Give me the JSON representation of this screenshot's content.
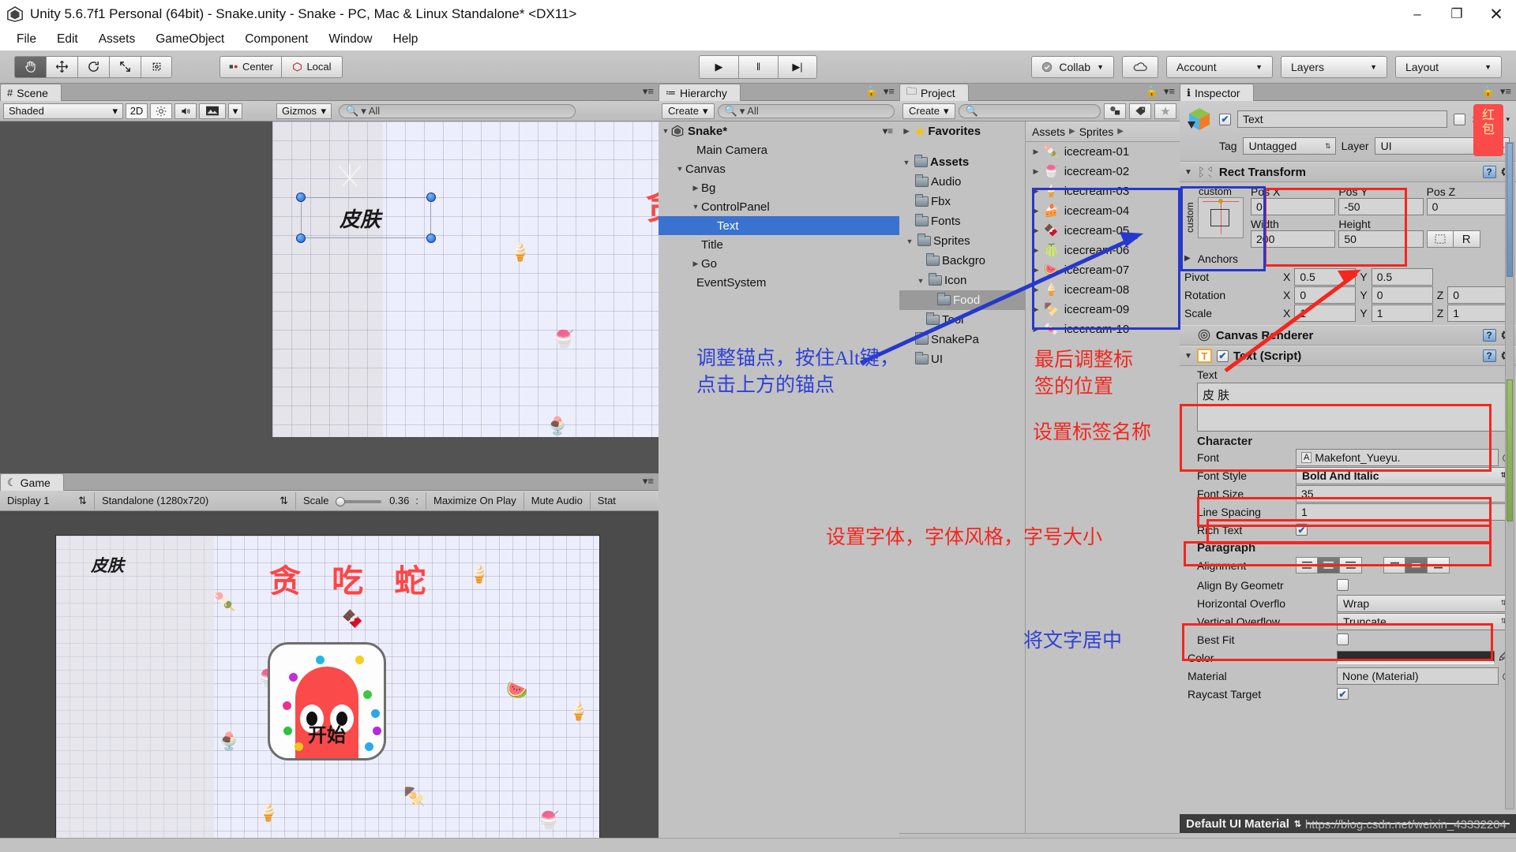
{
  "window": {
    "title": "Unity 5.6.7f1 Personal (64bit) - Snake.unity - Snake - PC, Mac & Linux Standalone* <DX11>",
    "minimize": "–",
    "maximize": "❐",
    "close": "✕"
  },
  "menubar": {
    "items": [
      "File",
      "Edit",
      "Assets",
      "GameObject",
      "Component",
      "Window",
      "Help"
    ]
  },
  "toolbar": {
    "tools": [
      "hand-tool",
      "move-tool",
      "rotate-tool",
      "scale-tool",
      "rect-tool"
    ],
    "pivot_mode": "Center",
    "pivot_rotation": "Local",
    "play": "▶",
    "pause": "‖",
    "step": "▶|",
    "collab": "Collab",
    "cloud": "☁",
    "account": "Account",
    "layers": "Layers",
    "layout": "Layout"
  },
  "scene": {
    "tab": "Scene",
    "tab_icon": "grid-icon",
    "draw_mode": "Shaded",
    "mode_2d": "2D",
    "lighting_icon": "sun-icon",
    "audio_icon": "speaker-icon",
    "effects_icon": "image-icon",
    "gizmos": "Gizmos",
    "search_placeholder": "All",
    "selected_text": "皮肤"
  },
  "game": {
    "tab": "Game",
    "tab_icon": "gamepad-icon",
    "display": "Display 1",
    "resolution": "Standalone (1280x720)",
    "scale_label": "Scale",
    "scale_value": "0.36",
    "maximize_on_play": "Maximize On Play",
    "mute_audio": "Mute Audio",
    "stats": "Stat",
    "skin_label": "皮肤",
    "game_title": "贪 吃 蛇",
    "start_label": "开始"
  },
  "hierarchy": {
    "tab": "Hierarchy",
    "create": "Create",
    "search_placeholder": "All",
    "root": "Snake*",
    "items": [
      {
        "label": "Main Camera",
        "depth": 1,
        "arrow": "none"
      },
      {
        "label": "Canvas",
        "depth": 1,
        "arrow": "open"
      },
      {
        "label": "Bg",
        "depth": 2,
        "arrow": "closed"
      },
      {
        "label": "ControlPanel",
        "depth": 2,
        "arrow": "open"
      },
      {
        "label": "Text",
        "depth": 3,
        "arrow": "none",
        "selected": true
      },
      {
        "label": "Title",
        "depth": 2,
        "arrow": "none"
      },
      {
        "label": "Go",
        "depth": 2,
        "arrow": "closed"
      },
      {
        "label": "EventSystem",
        "depth": 1,
        "arrow": "none"
      }
    ]
  },
  "project": {
    "tab": "Project",
    "create": "Create",
    "search_placeholder": "",
    "favorites": "Favorites",
    "breadcrumb": [
      "Assets",
      "Sprites"
    ],
    "tree": [
      {
        "label": "Assets",
        "depth": 0,
        "arrow": "open",
        "bold": true
      },
      {
        "label": "Audio",
        "depth": 1,
        "arrow": "none"
      },
      {
        "label": "Fbx",
        "depth": 1,
        "arrow": "none"
      },
      {
        "label": "Fonts",
        "depth": 1,
        "arrow": "none"
      },
      {
        "label": "Sprites",
        "depth": 1,
        "arrow": "open"
      },
      {
        "label": "Backgro",
        "depth": 2,
        "arrow": "none"
      },
      {
        "label": "Icon",
        "depth": 2,
        "arrow": "open"
      },
      {
        "label": "Food",
        "depth": 3,
        "arrow": "none",
        "selected": true
      },
      {
        "label": "Tool",
        "depth": 3,
        "arrow": "none"
      },
      {
        "label": "SnakePa",
        "depth": 2,
        "arrow": "none"
      },
      {
        "label": "UI",
        "depth": 2,
        "arrow": "none"
      }
    ],
    "assets": [
      "icecream-01",
      "icecream-02",
      "icecream-03",
      "icecream-04",
      "icecream-05",
      "icecream-06",
      "icecream-07",
      "icecream-08",
      "icecream-09",
      "icecream-10"
    ]
  },
  "inspector": {
    "tab": "Inspector",
    "object_name": "Text",
    "enabled": true,
    "static_label": "Static",
    "static_checked": false,
    "tag_label": "Tag",
    "tag_value": "Untagged",
    "layer_label": "Layer",
    "layer_value": "UI",
    "rect_transform": {
      "title": "Rect Transform",
      "anchor_preset_top": "custom",
      "anchor_preset_left": "custom",
      "anchors_label": "Anchors",
      "pos_x_label": "Pos X",
      "pos_x": "0",
      "pos_y_label": "Pos Y",
      "pos_y": "-50",
      "pos_z_label": "Pos Z",
      "pos_z": "0",
      "width_label": "Width",
      "width": "200",
      "height_label": "Height",
      "height": "50",
      "blueprint_btn": "blueprint-icon",
      "raw_btn": "R",
      "pivot_label": "Pivot",
      "pivot_x": "0.5",
      "pivot_y": "0.5",
      "rotation_label": "Rotation",
      "rot_x": "0",
      "rot_y": "0",
      "rot_z": "0",
      "scale_label": "Scale",
      "scale_x": "1",
      "scale_y": "1",
      "scale_z": "1"
    },
    "canvas_renderer": {
      "title": "Canvas Renderer"
    },
    "text_script": {
      "title": "Text (Script)",
      "enabled": true,
      "text_label": "Text",
      "text_value": "皮 肤",
      "character_header": "Character",
      "font_label": "Font",
      "font_value": "Makefont_Yueyu.",
      "font_style_label": "Font Style",
      "font_style_value": "Bold And Italic",
      "font_size_label": "Font Size",
      "font_size_value": "35",
      "line_spacing_label": "Line Spacing",
      "line_spacing_value": "1",
      "rich_text_label": "Rich Text",
      "rich_text_checked": true,
      "paragraph_header": "Paragraph",
      "alignment_label": "Alignment",
      "align_h_selected": 1,
      "align_v_selected": 1,
      "align_by_geometry_label": "Align By Geometr",
      "align_by_geometry_checked": false,
      "horizontal_overflow_label": "Horizontal Overflo",
      "horizontal_overflow_value": "Wrap",
      "vertical_overflow_label": "Vertical Overflow",
      "vertical_overflow_value": "Truncate",
      "best_fit_label": "Best Fit",
      "best_fit_checked": false,
      "color_label": "Color",
      "color_value": "#2b2b2b",
      "material_label": "Material",
      "material_value": "None (Material)",
      "raycast_target_label": "Raycast Target",
      "raycast_target_checked": true
    },
    "material_bar": "Default UI Material",
    "watermark": "https://blog.csdn.net/weixin_43332204",
    "red_packet": "红\n包"
  },
  "annotations": [
    {
      "id": "anchor-note",
      "text": "调整锚点，按住Alt键，\n点击上方的锚点",
      "color": "#2f41d8"
    },
    {
      "id": "position-note",
      "text": "最后调整标\n签的位置",
      "color": "#f4261f"
    },
    {
      "id": "label-name-note",
      "text": "设置标签名称",
      "color": "#f4261f"
    },
    {
      "id": "font-note",
      "text": "设置字体，字体风格，字号大小",
      "color": "#f4261f"
    },
    {
      "id": "center-note",
      "text": "将文字居中",
      "color": "#2f41d8"
    }
  ],
  "colors": {
    "selection_blue": "#3a72cf",
    "annotation_red": "#f4261f",
    "annotation_blue": "#2f41d8",
    "snake_red": "#fb4a4a",
    "title_red": "#ff4545"
  }
}
